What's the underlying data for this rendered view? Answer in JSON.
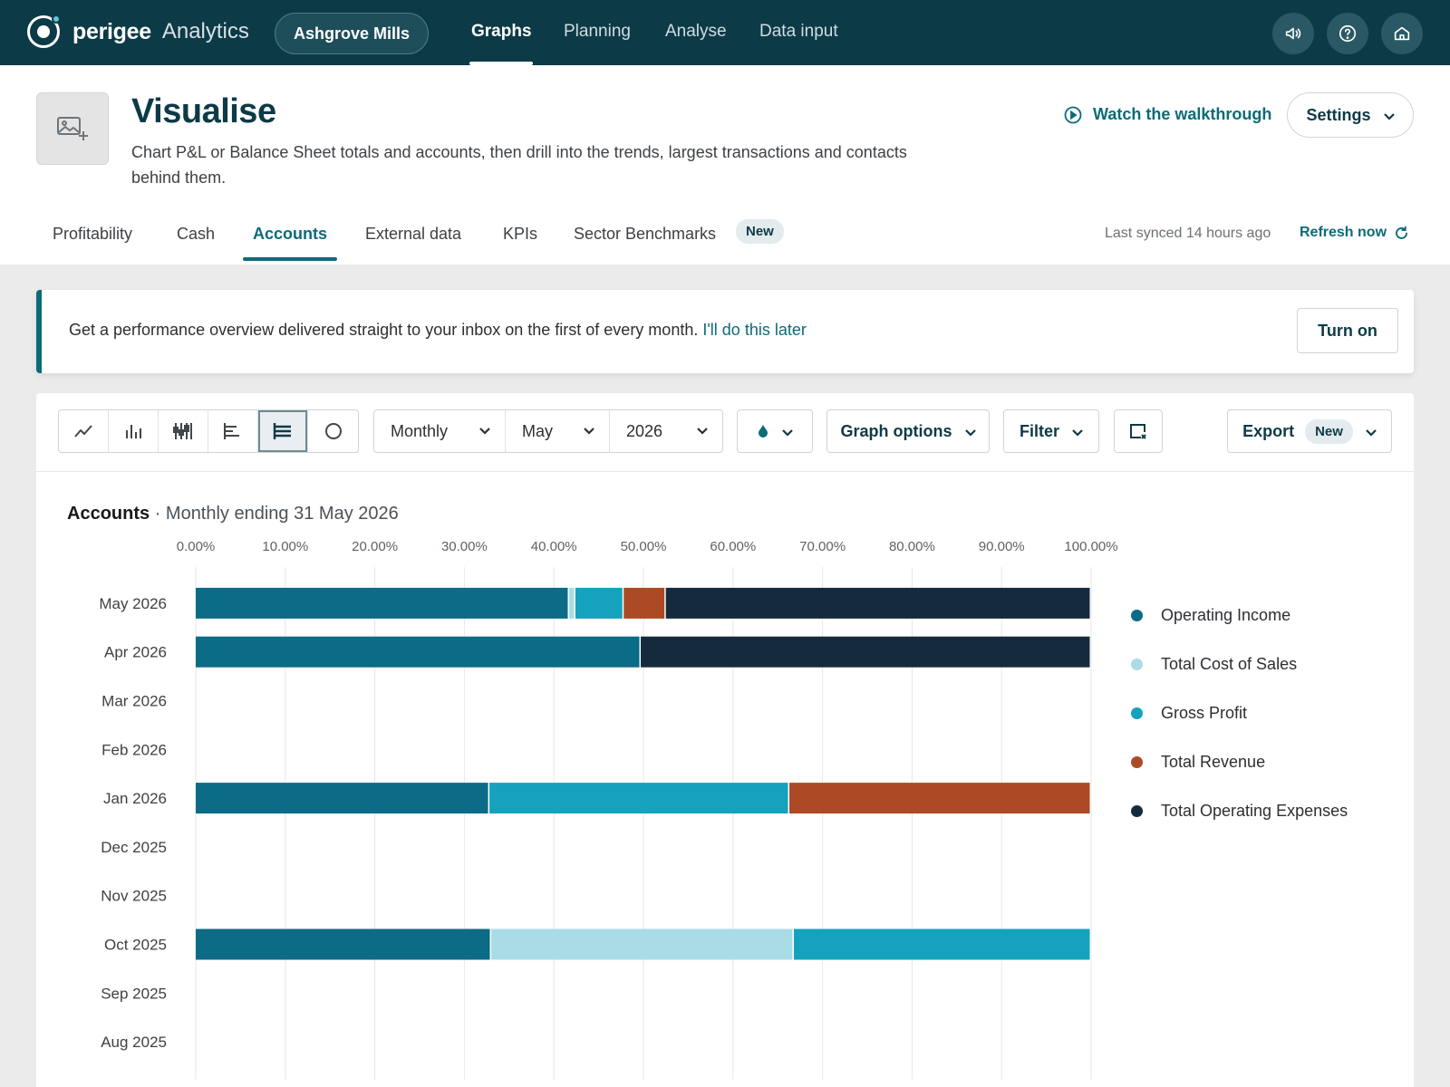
{
  "nav": {
    "brand_name": "perigee",
    "brand_product": "Analytics",
    "org": "Ashgrove Mills",
    "links": [
      "Graphs",
      "Planning",
      "Analyse",
      "Data input"
    ],
    "active": "Graphs",
    "icons": [
      "announcement-icon",
      "help-icon",
      "home-icon"
    ]
  },
  "header": {
    "title": "Visualise",
    "description": "Chart P&L or Balance Sheet totals and accounts, then drill into the trends, largest transactions and contacts behind them.",
    "walkthrough": "Watch the walkthrough",
    "settings": "Settings",
    "tabs": [
      "Profitability",
      "Cash",
      "Accounts",
      "External data",
      "KPIs",
      "Sector Benchmarks"
    ],
    "active_tab": "Accounts",
    "tab_badge": "New",
    "last_synced": "Last synced 14 hours ago",
    "refresh": "Refresh now"
  },
  "banner": {
    "text": "Get a performance overview delivered straight to your inbox on the first of every month.",
    "link": "I'll do this later",
    "button": "Turn on"
  },
  "toolbar": {
    "chart_types": [
      "line-chart-icon",
      "bar-chart-icon",
      "candlestick-icon",
      "horizontal-bar-icon",
      "stacked-bar-icon",
      "pie-chart-icon"
    ],
    "active_chart_type": "stacked-bar-icon",
    "period": "Monthly",
    "month": "May",
    "year": "2026",
    "graph_options": "Graph options",
    "filter": "Filter",
    "export": "Export",
    "export_badge": "New"
  },
  "chart_heading": {
    "bold": "Accounts",
    "sub": "· Monthly ending 31 May 2026"
  },
  "chart_data": {
    "type": "bar",
    "orientation": "horizontal",
    "stacked": "percent",
    "xlim": [
      0,
      100
    ],
    "xticks": [
      "0.00%",
      "10.00%",
      "20.00%",
      "30.00%",
      "40.00%",
      "50.00%",
      "60.00%",
      "70.00%",
      "80.00%",
      "90.00%",
      "100.00%"
    ],
    "categories": [
      "May 2026",
      "Apr 2026",
      "Mar 2026",
      "Feb 2026",
      "Jan 2026",
      "Dec 2025",
      "Nov 2025",
      "Oct 2025",
      "Sep 2025",
      "Aug 2025"
    ],
    "grid": true,
    "legend_position": "right",
    "series": [
      {
        "name": "Operating Income",
        "color": "#0c6b86",
        "values": [
          41.7,
          49.7,
          0,
          0,
          32.8,
          0,
          0,
          33.0,
          0,
          0
        ]
      },
      {
        "name": "Total Cost of Sales",
        "color": "#a9dce6",
        "values": [
          0.7,
          0,
          0,
          0,
          0,
          0,
          0,
          33.8,
          0,
          0
        ]
      },
      {
        "name": "Gross Profit",
        "color": "#15a2bd",
        "values": [
          5.4,
          0,
          0,
          0,
          33.5,
          0,
          0,
          33.2,
          0,
          0
        ]
      },
      {
        "name": "Total Revenue",
        "color": "#ab4a24",
        "values": [
          4.7,
          0,
          0,
          0,
          33.7,
          0,
          0,
          0,
          0,
          0
        ]
      },
      {
        "name": "Total Operating Expenses",
        "color": "#152b3d",
        "values": [
          47.5,
          50.3,
          0,
          0,
          0,
          0,
          0,
          0,
          0,
          0
        ]
      }
    ]
  }
}
